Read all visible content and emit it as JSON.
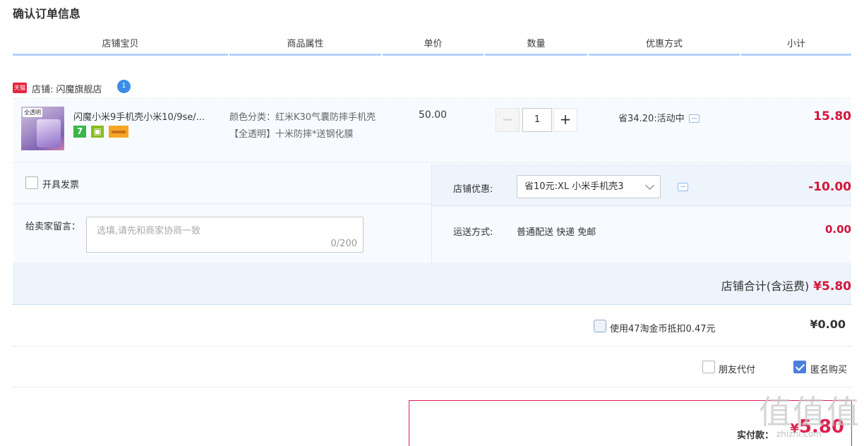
{
  "page": {
    "title": "确认订单信息"
  },
  "columns": [
    "店铺宝贝",
    "商品属性",
    "单价",
    "数量",
    "优惠方式",
    "小计"
  ],
  "shop": {
    "badge": "天猫",
    "label": "店铺: 闪魔旗舰店",
    "wangwang_badge": "1"
  },
  "item": {
    "thumb_tag": "全透明",
    "title": "闪魔小米9手机壳小米10/9se/...",
    "service_icons": [
      "7",
      "b",
      "c"
    ],
    "attr": "颜色分类：红米K30气囊防摔手机壳【全透明】十米防摔*送钢化膜",
    "price": "50.00",
    "quantity": "1",
    "qty_minus": "−",
    "qty_plus": "+",
    "discount": "省34.20:活动中",
    "subtotal": "15.80"
  },
  "options": {
    "invoice_label": "开具发票",
    "memo_label": "给卖家留言：",
    "memo_placeholder": "选填,请先和商家协商一致",
    "memo_count": "0/200",
    "shop_discount_label": "店铺优惠:",
    "shop_discount_selected": "省10元:XL 小米手机壳3",
    "shop_discount_value": "-10.00",
    "shipping_label": "运送方式:",
    "shipping_value": "普通配送 快递 免邮",
    "shipping_fee": "0.00",
    "total_label": "店铺合计(含运费)",
    "total_value": "¥5.80"
  },
  "coins": {
    "label": "使用47淘金币抵扣0.47元",
    "value": "¥0.00"
  },
  "purchase": {
    "friend_pay_label": "朋友代付",
    "anonymous_label": "匿名购买",
    "anonymous_checked": true
  },
  "pay": {
    "label": "实付款：",
    "currency": "¥",
    "value": "5.80"
  },
  "watermark": {
    "text": "值值值",
    "sub": "zhizhi.com"
  },
  "colors": {
    "price_red": "#d4153a",
    "accent_blue": "#4a7fe0",
    "header_rule": "#b2d1ff"
  }
}
